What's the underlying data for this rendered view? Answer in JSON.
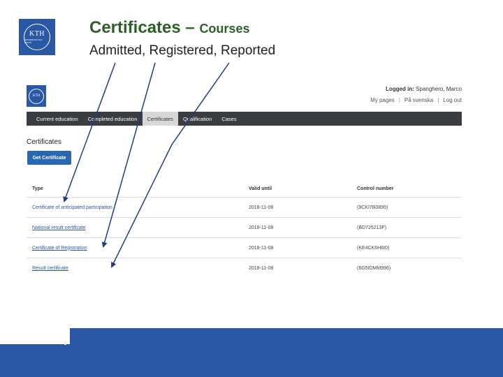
{
  "slide": {
    "title_main": "Certificates",
    "title_dash": "–",
    "title_sub": "Courses",
    "subtitle": "Admitted, Registered, Reported",
    "logo_text": "KTH",
    "logo_subtext": "VETENSKAP OCH KONST"
  },
  "app": {
    "logo_text": "KTH",
    "logged_in_label": "Logged in:",
    "logged_in_user": "Spanghero, Marco",
    "top_links": [
      "My pages",
      "På svenska",
      "Log out"
    ],
    "nav_tabs": [
      {
        "label": "Current education",
        "active": false
      },
      {
        "label": "Completed education",
        "active": false
      },
      {
        "label": "Certificates",
        "active": true
      },
      {
        "label": "Qualification",
        "active": false
      },
      {
        "label": "Cases",
        "active": false
      }
    ],
    "section_heading": "Certificates",
    "get_certificate_label": "Get Certificate",
    "table": {
      "headers": [
        "Type",
        "Valid until",
        "Control number"
      ],
      "rows": [
        {
          "type": "Certificate of anticipated participation",
          "valid_until": "2018-11-08",
          "control_number": "(9CKI7B0895)"
        },
        {
          "type": "National result certificate",
          "valid_until": "2018-11-08",
          "control_number": "(BD725213F)"
        },
        {
          "type": "Certificate of Registration",
          "valid_until": "2018-11-08",
          "control_number": "(KE4CK6H6I0)"
        },
        {
          "type": "Result certificate",
          "valid_until": "2018-11-08",
          "control_number": "(6G5IDMM996)"
        }
      ]
    }
  },
  "colors": {
    "brand_blue": "#2a57a6",
    "title_green": "#2f5f28",
    "navbar": "#3a3d42",
    "button_blue": "#2a67b1"
  }
}
